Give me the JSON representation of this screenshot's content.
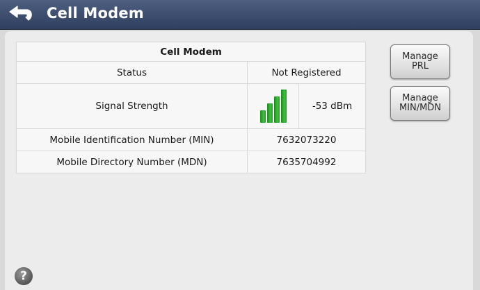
{
  "header": {
    "title": "Cell Modem",
    "back_icon": "back-arrow-icon"
  },
  "table": {
    "title": "Cell Modem",
    "rows": {
      "status": {
        "label": "Status",
        "value": "Not Registered"
      },
      "signal": {
        "label": "Signal Strength",
        "value": "-53 dBm",
        "icon": "signal-bars-icon",
        "bars_filled": 4,
        "bars_total": 4
      },
      "min": {
        "label": "Mobile Identification Number (MIN)",
        "value": "7632073220"
      },
      "mdn": {
        "label": "Mobile Directory Number (MDN)",
        "value": "7635704992"
      }
    }
  },
  "buttons": {
    "manage_prl": {
      "line1": "Manage",
      "line2": "PRL"
    },
    "manage_min_mdn": {
      "line1": "Manage",
      "line2": "MIN/MDN"
    }
  },
  "help": {
    "icon": "help-icon",
    "glyph": "?"
  },
  "colors": {
    "titlebar": "#3c4d6e",
    "signal_green": "#2ea82e",
    "background": "#d9d9d9"
  }
}
